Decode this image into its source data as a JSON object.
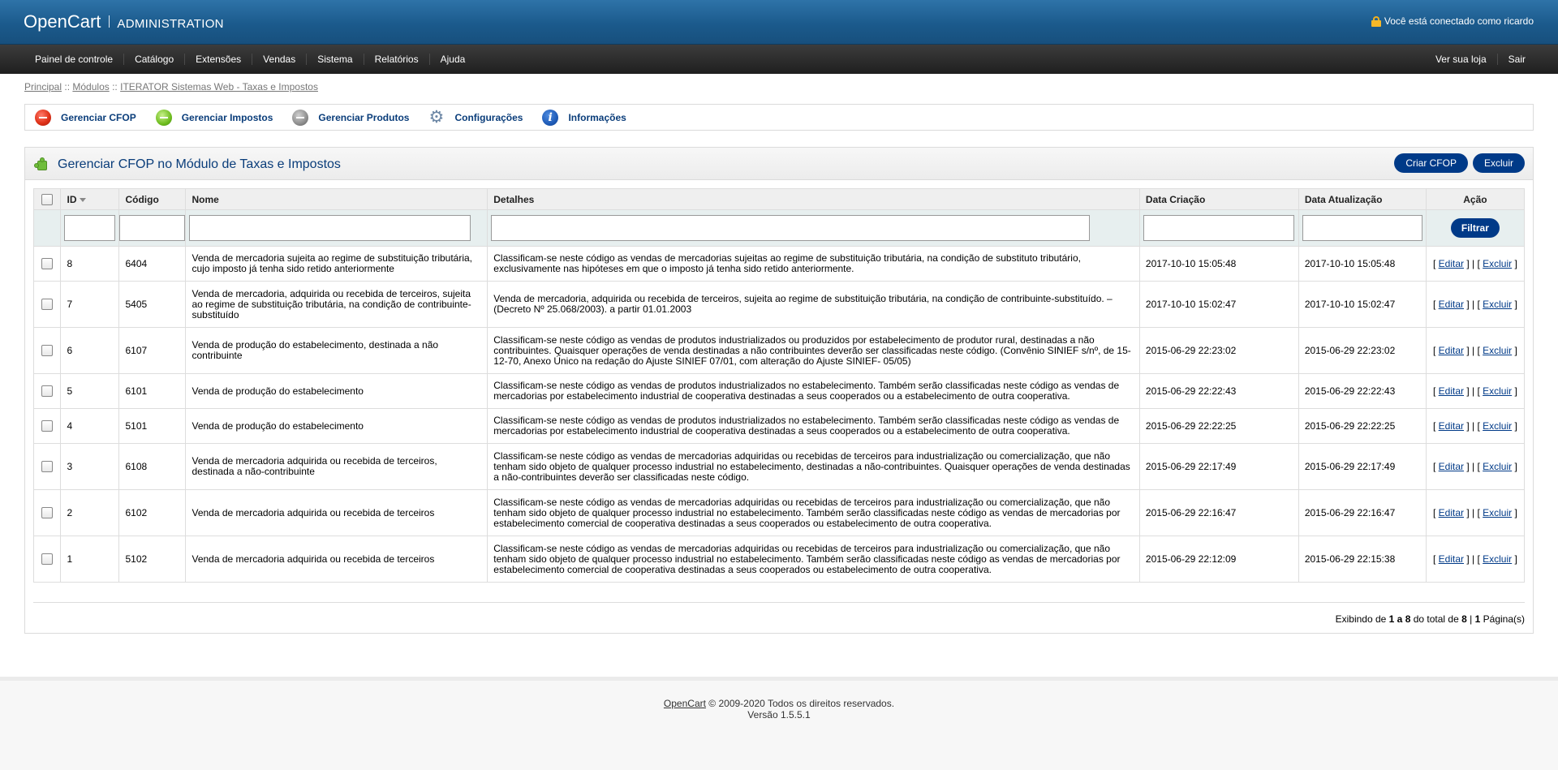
{
  "header": {
    "logo": "OpenCart",
    "subtitle": "ADMINISTRATION",
    "logged_in_text": "Você está conectado como ricardo"
  },
  "menu": {
    "left": [
      "Painel de controle",
      "Catálogo",
      "Extensões",
      "Vendas",
      "Sistema",
      "Relatórios",
      "Ajuda"
    ],
    "right": [
      "Ver sua loja",
      "Sair"
    ]
  },
  "breadcrumb": {
    "items": [
      "Principal",
      "Módulos",
      "ITERATOR Sistemas Web - Taxas e Impostos"
    ],
    "separator": "::"
  },
  "module_tabs": [
    {
      "label": "Gerenciar CFOP",
      "icon": "minus-circle-red-icon"
    },
    {
      "label": "Gerenciar Impostos",
      "icon": "minus-circle-green-icon"
    },
    {
      "label": "Gerenciar Produtos",
      "icon": "minus-circle-grey-icon"
    },
    {
      "label": "Configurações",
      "icon": "gear-icon"
    },
    {
      "label": "Informações",
      "icon": "info-icon"
    }
  ],
  "box": {
    "title": "Gerenciar CFOP no Módulo de Taxas e Impostos",
    "create_button": "Criar CFOP",
    "delete_button": "Excluir"
  },
  "table": {
    "columns": {
      "id": "ID",
      "code": "Código",
      "name": "Nome",
      "details": "Detalhes",
      "created": "Data Criação",
      "updated": "Data Atualização",
      "action": "Ação"
    },
    "filter_button": "Filtrar",
    "edit_label": "Editar",
    "delete_label": "Excluir",
    "rows": [
      {
        "id": "8",
        "code": "6404",
        "name": "Venda de mercadoria sujeita ao regime de substituição tributária, cujo imposto já tenha sido retido anteriormente",
        "details": "Classificam-se neste código as vendas de mercadorias sujeitas ao regime de substituição tributária, na condição de substituto tributário, exclusivamente nas hipóteses em que o imposto já tenha sido retido anteriormente.",
        "created": "2017-10-10 15:05:48",
        "updated": "2017-10-10 15:05:48"
      },
      {
        "id": "7",
        "code": "5405",
        "name": "Venda de mercadoria, adquirida ou recebida de terceiros, sujeita ao regime de substituição tributária, na condição de contribuinte-substituído",
        "details": "Venda de mercadoria, adquirida ou recebida de terceiros, sujeita ao regime de substituição tributária, na condição de contribuinte-substituído. – (Decreto Nº 25.068/2003). a partir 01.01.2003",
        "created": "2017-10-10 15:02:47",
        "updated": "2017-10-10 15:02:47"
      },
      {
        "id": "6",
        "code": "6107",
        "name": "Venda de produção do estabelecimento, destinada a não contribuinte",
        "details": "Classificam-se neste código as vendas de produtos industrializados ou produzidos por estabelecimento de produtor rural, destinadas a não contribuintes. Quaisquer operações de venda destinadas a não contribuintes deverão ser classificadas neste código. (Convênio SINIEF s/nº, de 15-12-70, Anexo Único na redação do Ajuste SINIEF 07/01, com alteração do Ajuste SINIEF- 05/05)",
        "created": "2015-06-29 22:23:02",
        "updated": "2015-06-29 22:23:02"
      },
      {
        "id": "5",
        "code": "6101",
        "name": "Venda de produção do estabelecimento",
        "details": "Classificam-se neste código as vendas de produtos industrializados no estabelecimento. Também serão classificadas neste código as vendas de mercadorias por estabelecimento industrial de cooperativa destinadas a seus cooperados ou a estabelecimento de outra cooperativa.",
        "created": "2015-06-29 22:22:43",
        "updated": "2015-06-29 22:22:43"
      },
      {
        "id": "4",
        "code": "5101",
        "name": "Venda de produção do estabelecimento",
        "details": "Classificam-se neste código as vendas de produtos industrializados no estabelecimento. Também serão classificadas neste código as vendas de mercadorias por estabelecimento industrial de cooperativa destinadas a seus cooperados ou a estabelecimento de outra cooperativa.",
        "created": "2015-06-29 22:22:25",
        "updated": "2015-06-29 22:22:25"
      },
      {
        "id": "3",
        "code": "6108",
        "name": "Venda de mercadoria adquirida ou recebida de terceiros, destinada a não-contribuinte",
        "details": "Classificam-se neste código as vendas de mercadorias adquiridas ou recebidas de terceiros para industrialização ou comercialização, que não tenham sido objeto de qualquer processo industrial no estabelecimento, destinadas a não-contribuintes. Quaisquer operações de venda destinadas a não-contribuintes deverão ser classificadas neste código.",
        "created": "2015-06-29 22:17:49",
        "updated": "2015-06-29 22:17:49"
      },
      {
        "id": "2",
        "code": "6102",
        "name": "Venda de mercadoria adquirida ou recebida de terceiros",
        "details": "Classificam-se neste código as vendas de mercadorias adquiridas ou recebidas de terceiros para industrialização ou comercialização, que não tenham sido objeto de qualquer processo industrial no estabelecimento. Também serão classificadas neste código as vendas de mercadorias por estabelecimento comercial de cooperativa destinadas a seus cooperados ou estabelecimento de outra cooperativa.",
        "created": "2015-06-29 22:16:47",
        "updated": "2015-06-29 22:16:47"
      },
      {
        "id": "1",
        "code": "5102",
        "name": "Venda de mercadoria adquirida ou recebida de terceiros",
        "details": "Classificam-se neste código as vendas de mercadorias adquiridas ou recebidas de terceiros para industrialização ou comercialização, que não tenham sido objeto de qualquer processo industrial no estabelecimento. Também serão classificadas neste código as vendas de mercadorias por estabelecimento comercial de cooperativa destinadas a seus cooperados ou estabelecimento de outra cooperativa.",
        "created": "2015-06-29 22:12:09",
        "updated": "2015-06-29 22:15:38"
      }
    ]
  },
  "pagination": {
    "prefix": "Exibindo de",
    "range": "1 a 8",
    "middle": "do total de",
    "total": "8",
    "sep": "|",
    "pages": "1",
    "suffix": "Página(s)"
  },
  "footer": {
    "link": "OpenCart",
    "copyright": "© 2009-2020 Todos os direitos reservados.",
    "version": "Versão 1.5.5.1"
  },
  "colors": {
    "header_blue": "#1b5a8c",
    "menu_dark": "#2a2a2a",
    "link_blue": "#0a3d7a",
    "button_blue": "#003a88"
  }
}
